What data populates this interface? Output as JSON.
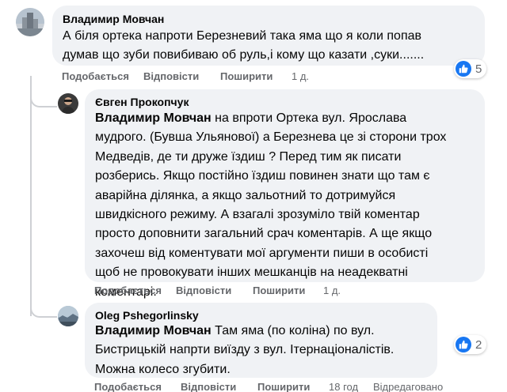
{
  "comments": [
    {
      "author": "Владимир Мовчан",
      "lines": [
        "А біля ортека напроти Березневий така яма що я коли попав",
        "думав що зуби повибиваю об руль,і кому що казати ,суки......."
      ],
      "actions": {
        "like": "Подобається",
        "reply": "Відповісти",
        "share": "Поширити",
        "time": "1 д."
      },
      "reactions": {
        "icon": "like-icon",
        "count": "5"
      }
    },
    {
      "author": "Євген Прокопчук",
      "mention": "Владимир Мовчан",
      "lines": [
        " на впроти Ортека вул. Ярослава",
        "мудрого. (Бувша Ульянової) а Березнева це зі сторони трох",
        "Медведів, де ти друже їздиш ? Перед тим як писати",
        "розберись. Якщо постійно їздиш повинен знати що там є",
        "аварійна ділянка, а якщо зальотний то дотримуйся",
        "швидкісного режиму. А взагалі зрозуміло твій коментар",
        "просто доповнити загальний срач коментарів. А ще якщо",
        "захочеш від коментувати мої аргументи пиши в особисті",
        "щоб не провокувати інших мешканців на неадекватні",
        "коментарі."
      ],
      "actions": {
        "like": "Подобається",
        "reply": "Відповісти",
        "share": "Поширити",
        "time": "1 д."
      }
    },
    {
      "author": "Oleg Pshegorlinsky",
      "mention": "Владимир Мовчан",
      "lines": [
        " Там яма (по коліна) по вул.",
        "Бистрицькій напрти виїзду з вул. Ітернаціоналістів.",
        "Можна колесо згубити."
      ],
      "actions": {
        "like": "Подобається",
        "reply": "Відповісти",
        "share": "Поширити",
        "time": "18 год",
        "edited": "Відредаговано"
      },
      "reactions": {
        "icon": "like-icon",
        "count": "2"
      }
    }
  ],
  "colors": {
    "bubble": "#f0f2f5",
    "muted": "#65676b",
    "accent": "#1877f2",
    "line": "#ced0d4"
  }
}
